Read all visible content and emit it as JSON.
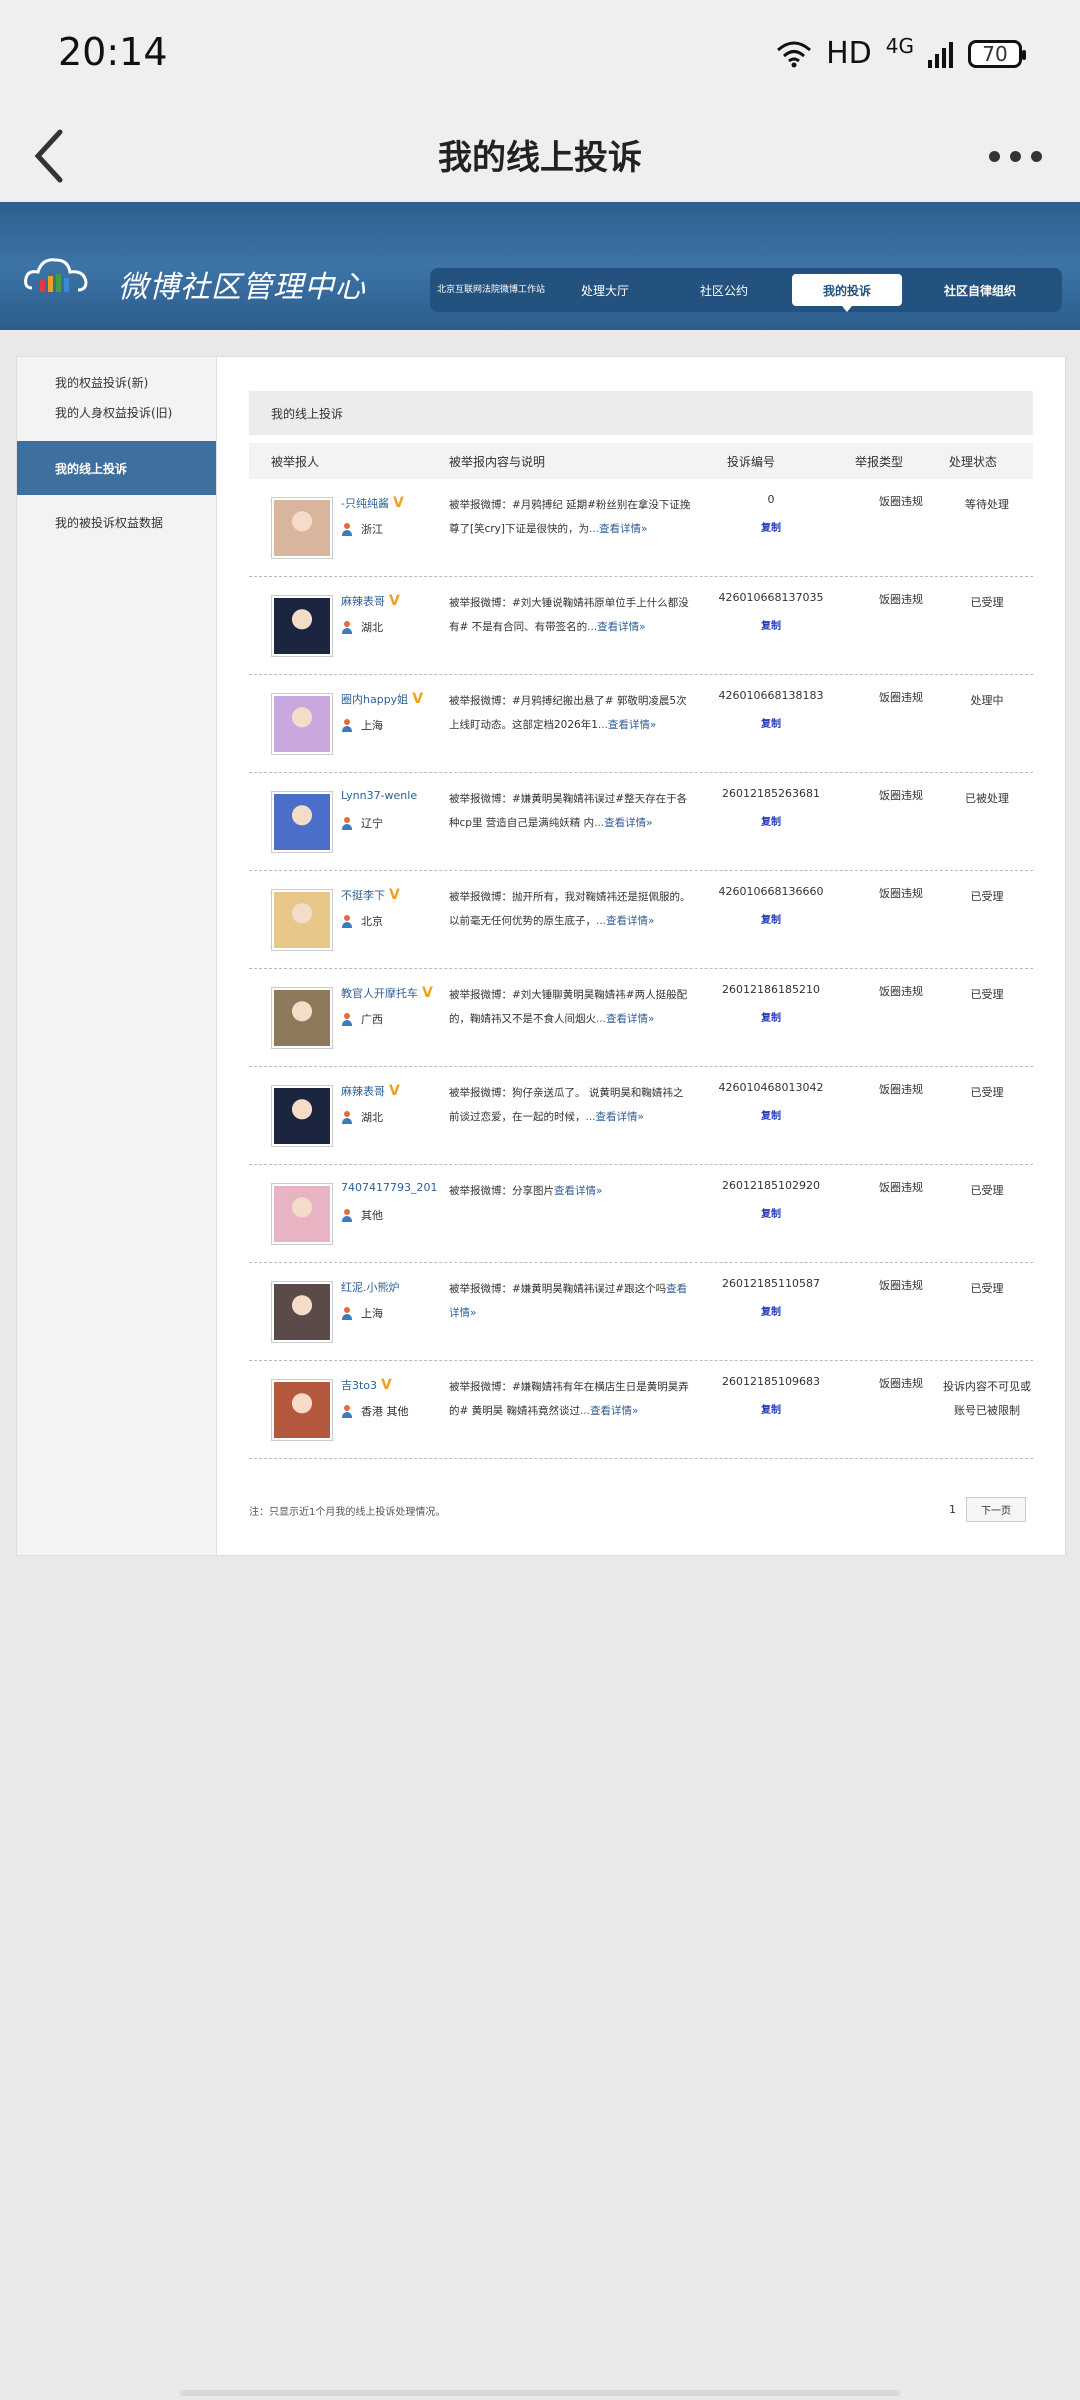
{
  "status_bar": {
    "time": "20:14",
    "hd": "HD",
    "network": "4G",
    "battery": "70"
  },
  "app_bar": {
    "title": "我的线上投诉"
  },
  "banner": {
    "title": "微博社区管理中心",
    "nav": [
      "北京互联网法院微博工作站",
      "处理大厅",
      "社区公约",
      "我的投诉",
      "社区自律组织"
    ]
  },
  "sidebar": {
    "items": [
      "我的权益投诉(新)",
      "我的人身权益投诉(旧)",
      "我的线上投诉",
      "我的被投诉权益数据"
    ]
  },
  "content": {
    "title": "我的线上投诉",
    "headers": [
      "被举报人",
      "被举报内容与说明",
      "投诉编号",
      "举报类型",
      "处理状态"
    ],
    "copy_label": "复制",
    "rows": [
      {
        "user": "-只纯纯酱",
        "verified": true,
        "location": "浙江",
        "desc": "被举报微博：#月鸦搏纪  延期#粉丝别在拿没下证挽尊了[笑cry]下证是很快的，为",
        "more": "...查看详情»",
        "code": "0",
        "type": "饭圈违规",
        "status": "等待处理",
        "avatar_color": "#d9b59e"
      },
      {
        "user": "麻辣表哥",
        "verified": true,
        "location": "湖北",
        "desc": "被举报微博：#刘大锤说鞠婧祎原单位手上什么都没有# 不是有合同、有带签名的",
        "more": "...查看详情»",
        "code": "426010668137035",
        "type": "饭圈违规",
        "status": "已受理",
        "avatar_color": "#1c2540"
      },
      {
        "user": "圈内happy姐",
        "verified": true,
        "location": "上海",
        "desc": "被举报微博：#月鸦搏纪搬出悬了# 郭敬明凌晨5次上线盯动态。这部定档2026年1",
        "more": "...查看详情»",
        "code": "426010668138183",
        "type": "饭圈违规",
        "status": "处理中",
        "avatar_color": "#c9a8e0"
      },
      {
        "user": "Lynn37-wenle",
        "verified": false,
        "location": "辽宁",
        "desc": "被举报微博：#嫌黄明昊鞠婧祎误过#整天存在于各种cp里 营造自己是满纯妖精 内",
        "more": "...查看详情»",
        "code": "26012185263681",
        "type": "饭圈违规",
        "status": "已被处理",
        "avatar_color": "#4a6ec9"
      },
      {
        "user": "不挺李下",
        "verified": true,
        "location": "北京",
        "desc": "被举报微博：抛开所有，我对鞠婧祎还是挺佩服的。以前毫无任何优势的原生底子，",
        "more": "...查看详情»",
        "code": "426010668136660",
        "type": "饭圈违规",
        "status": "已受理",
        "avatar_color": "#e8c78a"
      },
      {
        "user": "教官人开摩托车",
        "verified": true,
        "location": "广西",
        "desc": "被举报微博：#刘大锤聊黄明昊鞠婧祎#两人挺般配的，鞠婧祎又不是不食人间烟火",
        "more": "...查看详情»",
        "code": "26012186185210",
        "type": "饭圈违规",
        "status": "已受理",
        "avatar_color": "#8d7a5a"
      },
      {
        "user": "麻辣表哥",
        "verified": true,
        "location": "湖北",
        "desc": "被举报微博：狗仔亲送瓜了。 说黄明昊和鞠婧祎之前谈过恋爱，在一起的时候，",
        "more": "...查看详情»",
        "code": "426010468013042",
        "type": "饭圈违规",
        "status": "已受理",
        "avatar_color": "#1c2540"
      },
      {
        "user": "7407417793_201",
        "verified": false,
        "location": "其他",
        "desc": "被举报微博：分享图片",
        "more": "查看详情»",
        "code": "26012185102920",
        "type": "饭圈违规",
        "status": "已受理",
        "avatar_color": "#e8b4c4"
      },
      {
        "user": "红泥.小熊炉",
        "verified": false,
        "location": "上海",
        "desc": "被举报微博：#嫌黄明昊鞠婧祎误过#跟这个吗",
        "more": "查看详情»",
        "code": "26012185110587",
        "type": "饭圈违规",
        "status": "已受理",
        "avatar_color": "#5a4a48"
      },
      {
        "user": "吉3to3",
        "verified": true,
        "location": "香港  其他",
        "desc": "被举报微博：#嫌鞠婧祎有年在横店生日是黄明昊弄的# 黄明昊 鞠婧祎竟然谈过",
        "more": "...查看详情»",
        "code": "26012185109683",
        "type": "饭圈违规",
        "status": "投诉内容不可见或账号已被限制",
        "avatar_color": "#b5593e"
      }
    ]
  },
  "footer": {
    "note": "注：只显示近1个月我的线上投诉处理情况。",
    "page": "1",
    "next": "下一页"
  }
}
